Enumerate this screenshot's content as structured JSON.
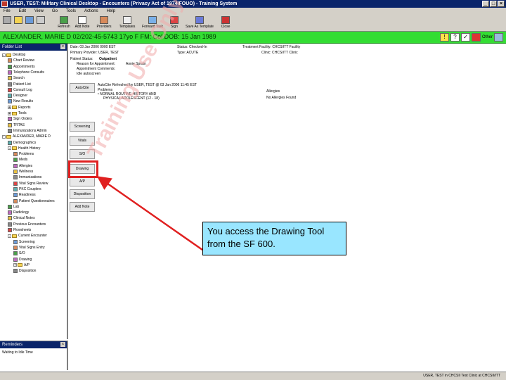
{
  "window": {
    "title": "USER, TEST: Military Clinical Desktop - Encounters (Privacy Act of 1974/FOUO) - Training System",
    "controls": [
      "_",
      "□",
      "×"
    ]
  },
  "menu": [
    "File",
    "Edit",
    "View",
    "Go",
    "Tools",
    "Actions",
    "Help"
  ],
  "toolbar": [
    {
      "label": "",
      "icon": "back-icon"
    },
    {
      "label": "Refresh",
      "icon": "refresh-icon"
    },
    {
      "label": "Add Note",
      "icon": "add-note-icon"
    },
    {
      "label": "Providers",
      "icon": "providers-icon"
    },
    {
      "label": "Templates",
      "icon": "templates-icon"
    },
    {
      "label": "Forward Task",
      "icon": "forward-task-icon"
    },
    {
      "label": "Sign",
      "icon": "sign-icon"
    },
    {
      "label": "Save As Template",
      "icon": "save-template-icon"
    },
    {
      "label": "Close",
      "icon": "close-icon"
    }
  ],
  "patient_bar": {
    "text": "ALEXANDER, MARIE D  02/202-45-5743  17yo  F  FM: Col  DOB: 15 Jan 1989",
    "color": "#33dd33",
    "icons": [
      "!",
      "?",
      "✓"
    ],
    "other_label": "Other"
  },
  "left_panel": {
    "title": "Folder List",
    "items": [
      {
        "label": "Desktop",
        "level": 0,
        "expand": "-"
      },
      {
        "label": "Chart Review",
        "level": 1
      },
      {
        "label": "Appointments",
        "level": 1
      },
      {
        "label": "Telephone Consults",
        "level": 1
      },
      {
        "label": "Search",
        "level": 1
      },
      {
        "label": "Patient List",
        "level": 1
      },
      {
        "label": "Consult Log",
        "level": 1
      },
      {
        "label": "Designer",
        "level": 1
      },
      {
        "label": "New Results",
        "level": 1
      },
      {
        "label": "Reports",
        "level": 1,
        "expand": "+"
      },
      {
        "label": "Tools",
        "level": 1,
        "expand": "+"
      },
      {
        "label": "Sign Orders",
        "level": 1
      },
      {
        "label": "TRTAS",
        "level": 1
      },
      {
        "label": "Immunizations Admin",
        "level": 1
      },
      {
        "label": "ALEXANDER, MARIE D",
        "level": 0,
        "expand": "-"
      },
      {
        "label": "Demographics",
        "level": 1
      },
      {
        "label": "Health History",
        "level": 1,
        "expand": "-"
      },
      {
        "label": "Problems",
        "level": 2
      },
      {
        "label": "Meds",
        "level": 2
      },
      {
        "label": "Allergies",
        "level": 2
      },
      {
        "label": "Wellness",
        "level": 2
      },
      {
        "label": "Immunizations",
        "level": 2
      },
      {
        "label": "Vital Signs Review",
        "level": 2
      },
      {
        "label": "PKC Couplers",
        "level": 2
      },
      {
        "label": "Readiness",
        "level": 2
      },
      {
        "label": "Patient Questionnaires",
        "level": 2
      },
      {
        "label": "Lab",
        "level": 1
      },
      {
        "label": "Radiology",
        "level": 1
      },
      {
        "label": "Clinical Notes",
        "level": 1
      },
      {
        "label": "Previous Encounters",
        "level": 1
      },
      {
        "label": "Flowsheets",
        "level": 1
      },
      {
        "label": "Current Encounter",
        "level": 1,
        "expand": "-"
      },
      {
        "label": "Screening",
        "level": 2
      },
      {
        "label": "Vital Signs Entry",
        "level": 2
      },
      {
        "label": "S/O",
        "level": 2
      },
      {
        "label": "Drawing",
        "level": 2
      },
      {
        "label": "A/P",
        "level": 2,
        "expand": "+"
      },
      {
        "label": "Disposition",
        "level": 2
      }
    ]
  },
  "reminders": {
    "title": "Reminders",
    "text": "Waiting to Idle Time"
  },
  "encounter_header": {
    "date": "Date: 03 Jan 2006 0900 EST",
    "primary_provider": "Primary Provider: USER, TEST",
    "patient_status_label": "Patient Status:",
    "patient_status": "Outpatient",
    "reason_label": "Reason for Appointment:",
    "reason": "Annie Sprain",
    "appt_comment": "Appointment Comments:",
    "idle": "Idle autoscreen",
    "status": "Status: Checked-In",
    "type": "Type: ACUTE",
    "treatment_facility": "Treatment Facility: CHCS/ITT Facility",
    "clinic": "Clinic: CHCS/ITT Clinic"
  },
  "side_buttons": [
    "AutoCite",
    "Screening",
    "Vitals",
    "S/O",
    "Drawing",
    "A/P",
    "Disposition",
    "Add Note"
  ],
  "autocite": {
    "header": "AutoCite Refreshed by USER, TEST @ 03 Jan 2006 11:45 EST",
    "problems_label": "Problems",
    "problem_1": "• NORMAL ROUTINE HISTORY AND",
    "problem_2": "PHYSICAL ADOLESCENT (12 - 18)",
    "allergies_label": "Allergies",
    "allergies_value": "No Allergies Found"
  },
  "callout": {
    "text": "You access the Drawing Tool from the SF 600.",
    "color": "#99e6ff"
  },
  "highlight_color": "#e02020",
  "watermark": "Training Use Only",
  "statusbar": {
    "text": "USER, TEST in CHCSII Test Clinic at CHCSII/ITT"
  }
}
